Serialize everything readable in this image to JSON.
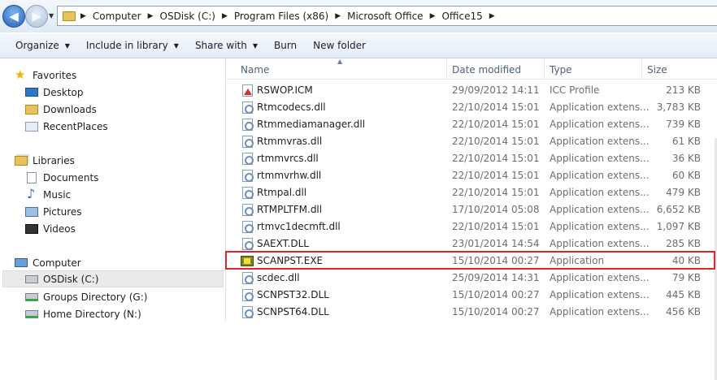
{
  "address": {
    "crumbs": [
      "Computer",
      "OSDisk (C:)",
      "Program Files (x86)",
      "Microsoft Office",
      "Office15"
    ]
  },
  "toolbar": {
    "organize": "Organize",
    "include_in_library": "Include in library",
    "share_with": "Share with",
    "burn": "Burn",
    "new_folder": "New folder"
  },
  "nav": {
    "favorites": "Favorites",
    "desktop": "Desktop",
    "downloads": "Downloads",
    "recent_places": "RecentPlaces",
    "libraries": "Libraries",
    "documents": "Documents",
    "music": "Music",
    "pictures": "Pictures",
    "videos": "Videos",
    "computer": "Computer",
    "osdisk": "OSDisk (C:)",
    "groups_directory": "Groups Directory (G:)",
    "home_directory": "Home Directory (N:)"
  },
  "columns": {
    "name": "Name",
    "date_modified": "Date modified",
    "type": "Type",
    "size": "Size"
  },
  "files": [
    {
      "name": "RSWOP.ICM",
      "date": "29/09/2012 14:11",
      "type": "ICC Profile",
      "size": "213 KB",
      "icon": "icm"
    },
    {
      "name": "Rtmcodecs.dll",
      "date": "22/10/2014 15:01",
      "type": "Application extens...",
      "size": "3,783 KB",
      "icon": "dll"
    },
    {
      "name": "Rtmmediamanager.dll",
      "date": "22/10/2014 15:01",
      "type": "Application extens...",
      "size": "739 KB",
      "icon": "dll"
    },
    {
      "name": "Rtmmvras.dll",
      "date": "22/10/2014 15:01",
      "type": "Application extens...",
      "size": "61 KB",
      "icon": "dll"
    },
    {
      "name": "rtmmvrcs.dll",
      "date": "22/10/2014 15:01",
      "type": "Application extens...",
      "size": "36 KB",
      "icon": "dll"
    },
    {
      "name": "rtmmvrhw.dll",
      "date": "22/10/2014 15:01",
      "type": "Application extens...",
      "size": "60 KB",
      "icon": "dll"
    },
    {
      "name": "Rtmpal.dll",
      "date": "22/10/2014 15:01",
      "type": "Application extens...",
      "size": "479 KB",
      "icon": "dll"
    },
    {
      "name": "RTMPLTFM.dll",
      "date": "17/10/2014 05:08",
      "type": "Application extens...",
      "size": "6,652 KB",
      "icon": "dll"
    },
    {
      "name": "rtmvc1decmft.dll",
      "date": "22/10/2014 15:01",
      "type": "Application extens...",
      "size": "1,097 KB",
      "icon": "dll"
    },
    {
      "name": "SAEXT.DLL",
      "date": "23/01/2014 14:54",
      "type": "Application extens...",
      "size": "285 KB",
      "icon": "dll"
    },
    {
      "name": "SCANPST.EXE",
      "date": "15/10/2014 00:27",
      "type": "Application",
      "size": "40 KB",
      "icon": "exe"
    },
    {
      "name": "scdec.dll",
      "date": "25/09/2014 14:31",
      "type": "Application extens...",
      "size": "79 KB",
      "icon": "dll"
    },
    {
      "name": "SCNPST32.DLL",
      "date": "15/10/2014 00:27",
      "type": "Application extens...",
      "size": "445 KB",
      "icon": "dll"
    },
    {
      "name": "SCNPST64.DLL",
      "date": "15/10/2014 00:27",
      "type": "Application extens...",
      "size": "456 KB",
      "icon": "dll"
    }
  ],
  "colors": {
    "highlight_border": "#d9262b",
    "selected_nav_bg": "#eaeaea"
  }
}
